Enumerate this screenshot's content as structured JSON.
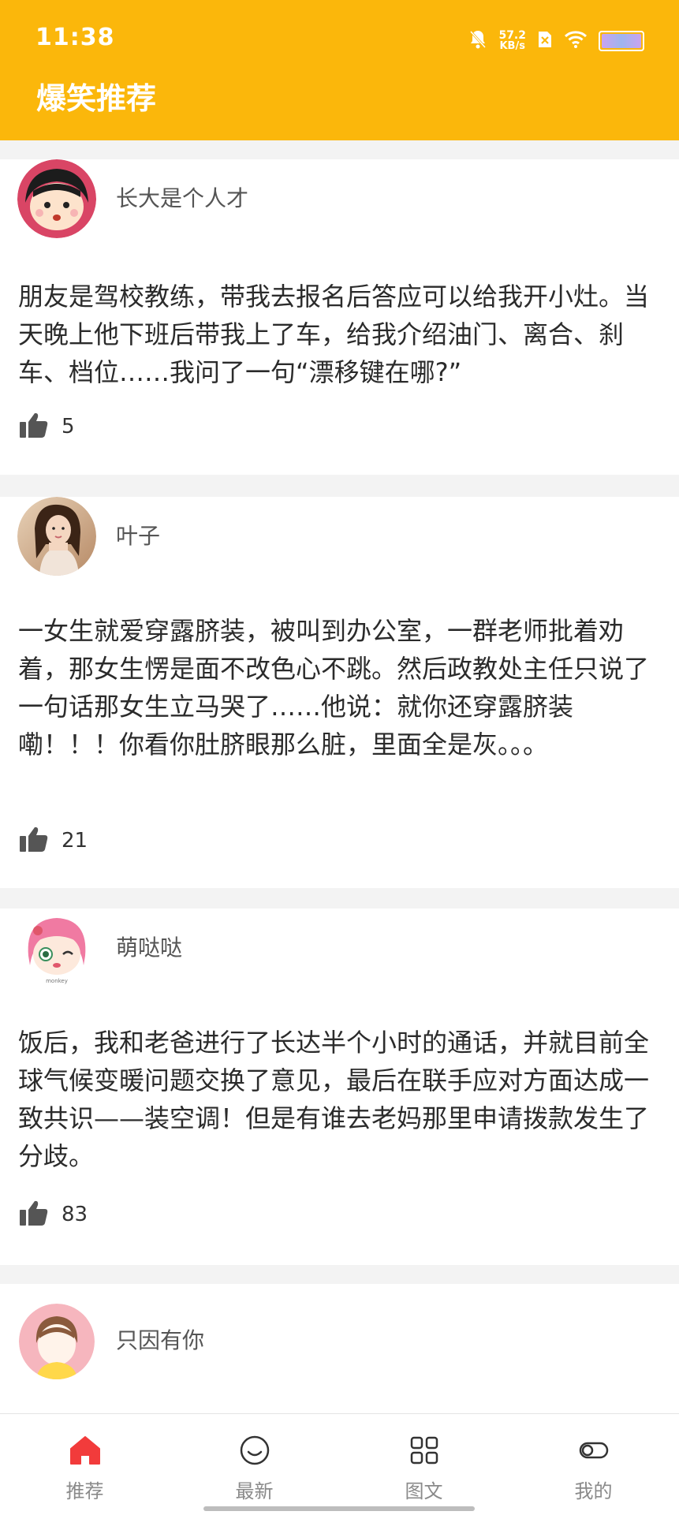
{
  "status_bar": {
    "time": "11:38",
    "net_speed_value": "57.2",
    "net_speed_unit": "KB/s",
    "icons": [
      "bell-muted-icon",
      "net-speed",
      "sim-x-icon",
      "wifi-icon",
      "battery-icon"
    ]
  },
  "header": {
    "title": "爆笑推荐"
  },
  "feed": {
    "posts": [
      {
        "username": "长大是个人才",
        "content": "朋友是驾校教练，带我去报名后答应可以给我开小灶。当天晚上他下班后带我上了车，给我介绍油门、离合、刹车、档位……我问了一句“漂移键在哪?”",
        "likes": "5"
      },
      {
        "username": "叶子",
        "content": "一女生就爱穿露脐装，被叫到办公室，一群老师批着劝着，那女生愣是面不改色心不跳。然后政教处主任只说了一句话那女生立马哭了……他说：就你还穿露脐装嘞！！！你看你肚脐眼那么脏，里面全是灰。。。",
        "likes": "21"
      },
      {
        "username": "萌哒哒",
        "content": "饭后，我和老爸进行了长达半个小时的通话，并就目前全球气候变暖问题交换了意见，最后在联手应对方面达成一致共识——装空调！但是有谁去老妈那里申请拨款发生了分歧。",
        "likes": "83"
      },
      {
        "username": "只因有你",
        "content": "",
        "likes": ""
      }
    ]
  },
  "tabbar": {
    "active_color": "#F23B3B",
    "tabs": [
      {
        "label": "推荐",
        "icon": "home-icon",
        "active": true
      },
      {
        "label": "最新",
        "icon": "smile-icon",
        "active": false
      },
      {
        "label": "图文",
        "icon": "grid-icon",
        "active": false
      },
      {
        "label": "我的",
        "icon": "profile-toggle-icon",
        "active": false
      }
    ]
  },
  "colors": {
    "brand": "#FBB70B",
    "background": "#F3F3F3"
  }
}
